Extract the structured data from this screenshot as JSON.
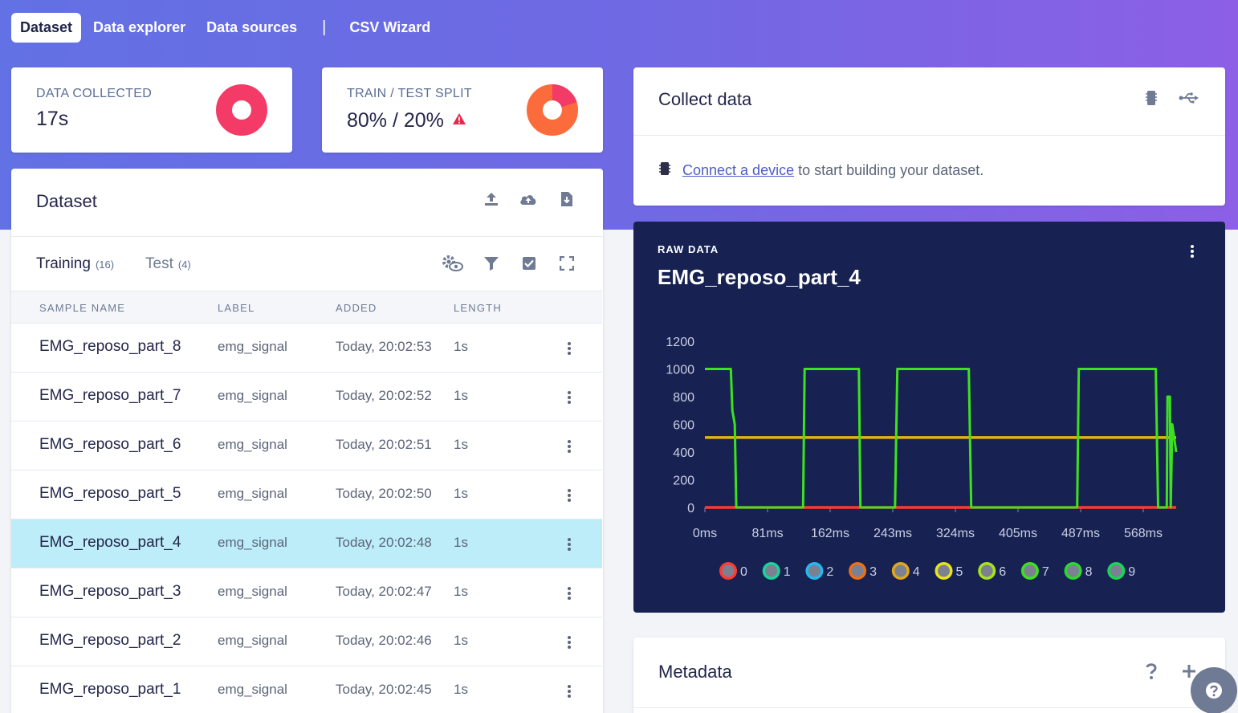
{
  "nav": {
    "tabs": [
      "Dataset",
      "Data explorer",
      "Data sources"
    ],
    "separator": "|",
    "csv_wizard": "CSV Wizard"
  },
  "stats": {
    "data_collected": {
      "title": "DATA COLLECTED",
      "value": "17s",
      "color": "#f43a66"
    },
    "train_test": {
      "title": "TRAIN / TEST SPLIT",
      "value": "80% / 20%",
      "color": "#fb6b3b",
      "train_fraction": 0.8
    }
  },
  "dataset": {
    "title": "Dataset",
    "tabs": {
      "training_label": "Training",
      "training_count": "(16)",
      "test_label": "Test",
      "test_count": "(4)"
    },
    "columns": {
      "name": "SAMPLE NAME",
      "label": "LABEL",
      "added": "ADDED",
      "length": "LENGTH"
    },
    "rows": [
      {
        "name": "EMG_reposo_part_8",
        "label": "emg_signal",
        "added": "Today, 20:02:53",
        "length": "1s"
      },
      {
        "name": "EMG_reposo_part_7",
        "label": "emg_signal",
        "added": "Today, 20:02:52",
        "length": "1s"
      },
      {
        "name": "EMG_reposo_part_6",
        "label": "emg_signal",
        "added": "Today, 20:02:51",
        "length": "1s"
      },
      {
        "name": "EMG_reposo_part_5",
        "label": "emg_signal",
        "added": "Today, 20:02:50",
        "length": "1s"
      },
      {
        "name": "EMG_reposo_part_4",
        "label": "emg_signal",
        "added": "Today, 20:02:48",
        "length": "1s"
      },
      {
        "name": "EMG_reposo_part_3",
        "label": "emg_signal",
        "added": "Today, 20:02:47",
        "length": "1s"
      },
      {
        "name": "EMG_reposo_part_2",
        "label": "emg_signal",
        "added": "Today, 20:02:46",
        "length": "1s"
      },
      {
        "name": "EMG_reposo_part_1",
        "label": "emg_signal",
        "added": "Today, 20:02:45",
        "length": "1s"
      }
    ],
    "selected_index": 4
  },
  "collect": {
    "title": "Collect data",
    "link_text": "Connect a device",
    "message": "to start building your dataset."
  },
  "raw_data": {
    "label": "RAW DATA",
    "sample_name": "EMG_reposo_part_4"
  },
  "chart_data": {
    "type": "line",
    "x_ticks": [
      "0ms",
      "81ms",
      "162ms",
      "243ms",
      "324ms",
      "405ms",
      "487ms",
      "568ms"
    ],
    "y_ticks": [
      "0",
      "200",
      "400",
      "600",
      "800",
      "1000",
      "1200"
    ],
    "ylim": [
      0,
      1200
    ],
    "xlim": [
      0,
      600
    ],
    "series": [
      {
        "name": "0",
        "color": "#ff3b30",
        "points": [
          [
            0,
            0
          ],
          [
            600,
            0
          ]
        ]
      },
      {
        "name": "4",
        "color": "#e2b60f",
        "points": [
          [
            0,
            505
          ],
          [
            600,
            505
          ]
        ]
      },
      {
        "name": "7",
        "color": "#3ce21e",
        "points": [
          [
            0,
            1000
          ],
          [
            33,
            1000
          ],
          [
            35,
            700
          ],
          [
            38,
            600
          ],
          [
            40,
            0
          ],
          [
            125,
            0
          ],
          [
            127,
            1000
          ],
          [
            196,
            1000
          ],
          [
            198,
            0
          ],
          [
            242,
            0
          ],
          [
            245,
            1000
          ],
          [
            336,
            1000
          ],
          [
            339,
            0
          ],
          [
            474,
            0
          ],
          [
            476,
            1000
          ],
          [
            574,
            1000
          ],
          [
            577,
            0
          ],
          [
            588,
            0
          ],
          [
            589,
            800
          ],
          [
            592,
            800
          ],
          [
            593,
            0
          ],
          [
            595,
            600
          ],
          [
            600,
            400
          ]
        ]
      }
    ],
    "legend": [
      "0",
      "1",
      "2",
      "3",
      "4",
      "5",
      "6",
      "7",
      "8",
      "9"
    ],
    "legend_colors": [
      "#ff3b30",
      "#19d49a",
      "#25b7ee",
      "#f06f13",
      "#e2a61b",
      "#e8e41a",
      "#a8e41a",
      "#3ce21e",
      "#2ad92e",
      "#19d650"
    ]
  },
  "metadata": {
    "title": "Metadata"
  }
}
